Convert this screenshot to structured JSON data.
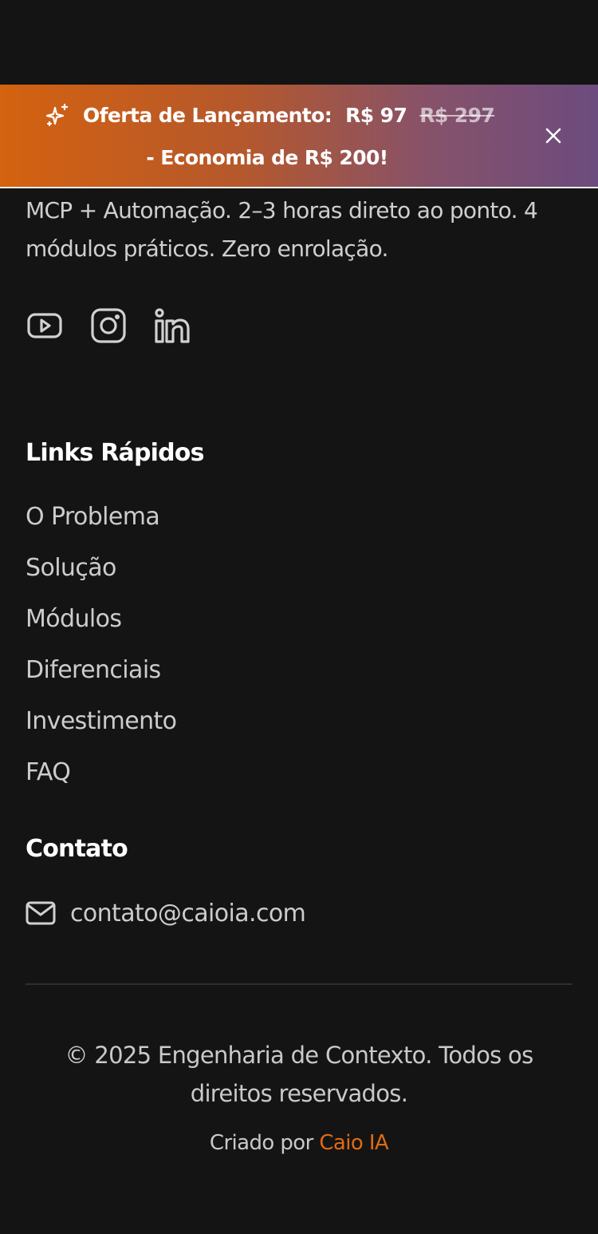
{
  "promo_banner": {
    "label": "Oferta de Lançamento:",
    "price": "R$ 97",
    "old_price": "R$ 297",
    "savings": "- Economia de R$ 200!",
    "icon": "sparkle-icon",
    "close_icon": "close-icon",
    "gradient_colors": [
      "#d4620f",
      "#6c4b7e"
    ]
  },
  "about": {
    "text": "MCP + Automação. 2–3 horas direto ao ponto. 4 módulos práticos. Zero enrolação."
  },
  "social": [
    "youtube-icon",
    "instagram-icon",
    "linkedin-icon"
  ],
  "quick_links": {
    "title": "Links Rápidos",
    "items": [
      "O Problema",
      "Solução",
      "Módulos",
      "Diferenciais",
      "Investimento",
      "FAQ"
    ]
  },
  "contact": {
    "title": "Contato",
    "icon": "mail-icon",
    "email": "contato@caioia.com"
  },
  "footer": {
    "copyright": "© 2025 Engenharia de Contexto. Todos os direitos reservados.",
    "credit_prefix": "Criado por",
    "credit_name": "Caio IA",
    "accent_color": "#e06a12"
  }
}
